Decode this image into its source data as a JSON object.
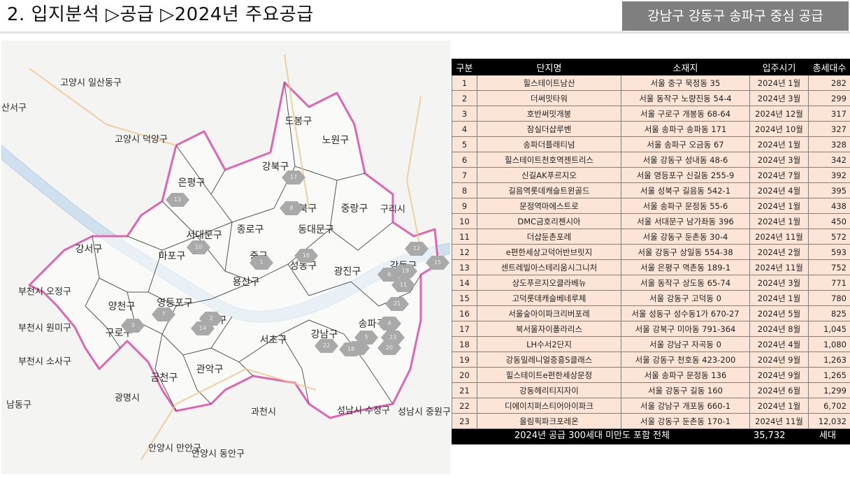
{
  "header": {
    "title": "2. 입지분석 ▷공급 ▷2024년 주요공급",
    "badge": "강남구 강동구 송파구 중심 공급"
  },
  "map": {
    "districts": [
      "도봉구",
      "노원구",
      "강북구",
      "은평구",
      "성북구",
      "중랑구",
      "서대문구",
      "종로구",
      "동대문구",
      "마포구",
      "중구",
      "성동구",
      "광진구",
      "강동구",
      "강서구",
      "양천구",
      "영등포구",
      "용산구",
      "구로구",
      "동작구",
      "서초구",
      "강남구",
      "송파구",
      "금천구",
      "관악구"
    ],
    "outside": [
      "고양시 일산동구",
      "고양시 덕양구",
      "산서구",
      "구리시",
      "부천시 오정구",
      "부천시 원미구",
      "부천시 소사구",
      "광명시",
      "과천시",
      "남동구",
      "안양시 만안구",
      "안양시 동안구",
      "성남시 수정구",
      "성남시 중원구"
    ],
    "markers": [
      "1",
      "2",
      "3",
      "4",
      "5",
      "6",
      "7",
      "8",
      "9",
      "10",
      "11",
      "12",
      "13",
      "14",
      "15",
      "16",
      "17",
      "18",
      "19",
      "20",
      "21",
      "22",
      "23"
    ]
  },
  "table": {
    "headers": [
      "구분",
      "단지명",
      "소재지",
      "입주시기",
      "총세대수"
    ],
    "rows": [
      [
        "1",
        "힐스테이트남산",
        "서울 중구 묵정동 35",
        "2024년 1월",
        "282"
      ],
      [
        "2",
        "더써밋타워",
        "서울 동작구 노량진동 54-4",
        "2024년 3월",
        "299"
      ],
      [
        "3",
        "호반써밋개봉",
        "서울 구로구 개봉동 68-64",
        "2024년 12월",
        "317"
      ],
      [
        "4",
        "잠실더샵루벤",
        "서울 송파구 송파동 171",
        "2024년 10월",
        "327"
      ],
      [
        "5",
        "송파더플래티넘",
        "서울 송파구 오금동 67",
        "2024년 1월",
        "328"
      ],
      [
        "6",
        "힐스테이트천호역젠트리스",
        "서울 강동구 성내동 48-6",
        "2024년 3월",
        "342"
      ],
      [
        "7",
        "신길AK푸르지오",
        "서울 영등포구 신길동 255-9",
        "2024년 7월",
        "392"
      ],
      [
        "8",
        "길음역롯데캐슬트윈골드",
        "서울 성북구 길음동 542-1",
        "2024년 4월",
        "395"
      ],
      [
        "9",
        "문정역마에스트로",
        "서울 송파구 문정동 55-6",
        "2024년 1월",
        "438"
      ],
      [
        "10",
        "DMC금호리첸시아",
        "서울 서대문구 남가좌동 396",
        "2024년 1월",
        "450"
      ],
      [
        "11",
        "더샵둔촌포레",
        "서울 강동구 둔촌동 30-4",
        "2024년 11월",
        "572"
      ],
      [
        "12",
        "e편한세상고덕어반브릿지",
        "서울 강동구 상일동 554-38",
        "2024년 2월",
        "593"
      ],
      [
        "13",
        "센트레빌아스테리움시그니처",
        "서울 은평구 역촌동 189-1",
        "2024년 11월",
        "752"
      ],
      [
        "14",
        "상도푸르지오클라베뉴",
        "서울 동작구 상도동 65-74",
        "2024년 3월",
        "771"
      ],
      [
        "15",
        "고덕롯데캐슬베네루체",
        "서울 강동구 고덕동 0",
        "2024년 1월",
        "780"
      ],
      [
        "16",
        "서울숲아이파크리버포레",
        "서울 성동구 성수동1가 670-27",
        "2024년 5월",
        "825"
      ],
      [
        "17",
        "북서울자이폴라리스",
        "서울 강북구 미아동 791-364",
        "2024년 8월",
        "1,045"
      ],
      [
        "18",
        "LH수서2단지",
        "서울 강남구 자곡동 0",
        "2024년 4월",
        "1,080"
      ],
      [
        "19",
        "강동밀레니얼중흥S클래스",
        "서울 강동구 천호동 423-200",
        "2024년 9월",
        "1,263"
      ],
      [
        "20",
        "힐스테이트e편한세상문정",
        "서울 송파구 문정동 136",
        "2024년 9월",
        "1,265"
      ],
      [
        "21",
        "강동헤리티지자이",
        "서울 강동구 길동 160",
        "2024년 6월",
        "1,299"
      ],
      [
        "22",
        "디에이치퍼스티어아이파크",
        "서울 강남구 개포동 660-1",
        "2024년 1월",
        "6,702"
      ],
      [
        "23",
        "올림픽파크포레온",
        "서울 강동구 둔촌동 170-1",
        "2024년 11월",
        "12,032"
      ]
    ],
    "total": {
      "label": "2024년 공급 300세대 미만도 포함 전체",
      "value": "35,732",
      "unit": "세대"
    }
  },
  "colors": {
    "table_fill": "#fce4d6",
    "header_bg": "#000000",
    "badge_bg": "#7f7f7f",
    "boundary": "#e066b0"
  }
}
